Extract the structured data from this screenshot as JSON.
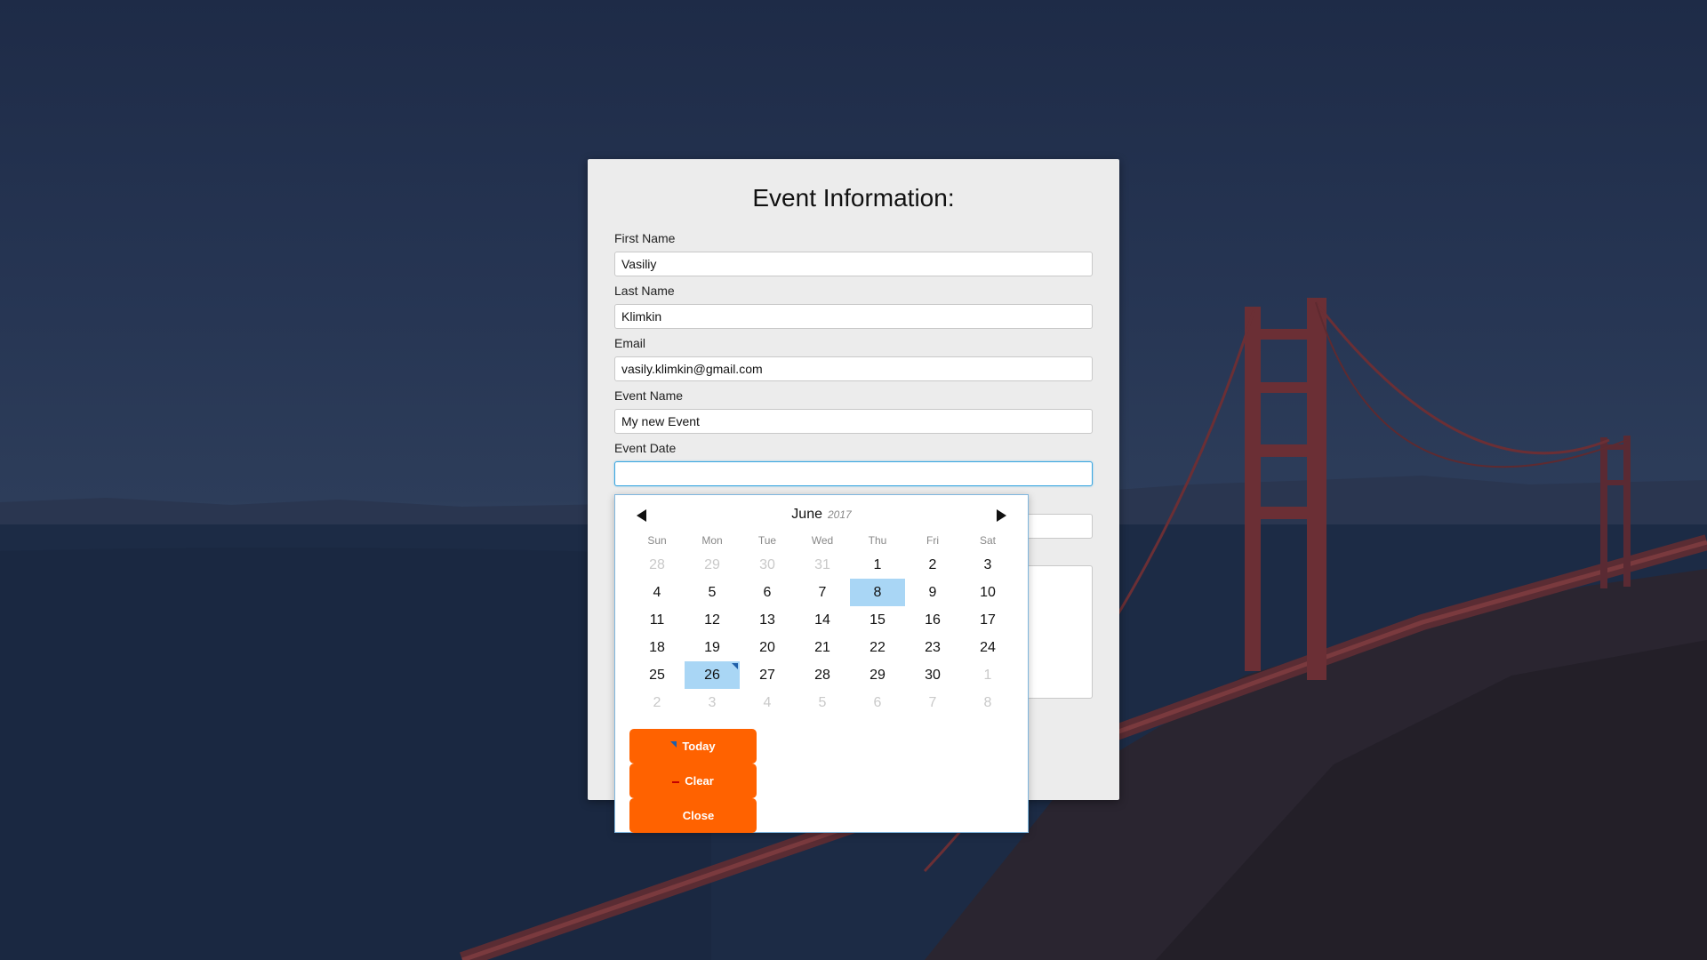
{
  "form": {
    "title": "Event Information:",
    "fields": [
      {
        "label": "First Name",
        "value": "Vasiliy"
      },
      {
        "label": "Last Name",
        "value": "Klimkin"
      },
      {
        "label": "Email",
        "value": "vasily.klimkin@gmail.com"
      },
      {
        "label": "Event Name",
        "value": "My new Event"
      },
      {
        "label": "Event Date",
        "value": ""
      }
    ]
  },
  "datepicker": {
    "month": "June",
    "year": "2017",
    "weekdays": [
      "Sun",
      "Mon",
      "Tue",
      "Wed",
      "Thu",
      "Fri",
      "Sat"
    ],
    "weeks": [
      [
        "28",
        "29",
        "30",
        "31",
        "1",
        "2",
        "3"
      ],
      [
        "4",
        "5",
        "6",
        "7",
        "8",
        "9",
        "10"
      ],
      [
        "11",
        "12",
        "13",
        "14",
        "15",
        "16",
        "17"
      ],
      [
        "18",
        "19",
        "20",
        "21",
        "22",
        "23",
        "24"
      ],
      [
        "25",
        "26",
        "27",
        "28",
        "29",
        "30",
        "1"
      ],
      [
        "2",
        "3",
        "4",
        "5",
        "6",
        "7",
        "8"
      ]
    ],
    "highlighted_day": "8",
    "selected_day": "26",
    "buttons": {
      "today": "Today",
      "clear": "Clear",
      "close": "Close"
    },
    "colors": {
      "button": "#ff6200",
      "highlight": "#a9d6f5",
      "border": "#7fb6de"
    }
  }
}
